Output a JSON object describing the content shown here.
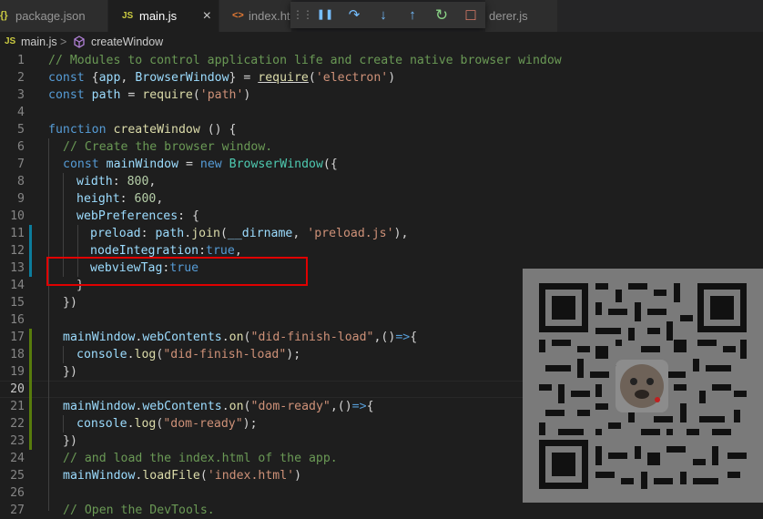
{
  "tabs": [
    {
      "icon": "{}",
      "label": "package.json"
    },
    {
      "icon": "JS",
      "label": "main.js",
      "close": "×"
    },
    {
      "icon": "<>",
      "label": "index.ht"
    },
    {
      "icon": "",
      "label": "derer.js"
    }
  ],
  "debug_toolbar": {
    "grip": "⋮⋮",
    "pause": "❚❚",
    "step_over": "↷",
    "step_into": "↓",
    "step_out": "↑",
    "restart": "↻",
    "stop": "□"
  },
  "breadcrumb": {
    "file_icon": "JS",
    "file": "main.js",
    "separator": ">",
    "symbol": "createWindow"
  },
  "editor": {
    "line_numbers": [
      "1",
      "2",
      "3",
      "4",
      "5",
      "6",
      "7",
      "8",
      "9",
      "10",
      "11",
      "12",
      "13",
      "14",
      "15",
      "16",
      "17",
      "18",
      "19",
      "20",
      "21",
      "22",
      "23",
      "24",
      "25",
      "26",
      "27"
    ],
    "lines": {
      "l1": {
        "a": "// Modules to control application life and create native browser window"
      },
      "l2": {
        "a": "const",
        "b": " {",
        "c": "app",
        "d": ", ",
        "e": "BrowserWindow",
        "f": "} = ",
        "g": "require",
        "h": "(",
        "i": "'electron'",
        "j": ")"
      },
      "l3": {
        "a": "const",
        "b": " ",
        "c": "path",
        "d": " = ",
        "e": "require",
        "f": "(",
        "g": "'path'",
        "h": ")"
      },
      "l5": {
        "a": "function",
        "b": " ",
        "c": "createWindow",
        "d": " () {"
      },
      "l6": {
        "a": "// Create the browser window."
      },
      "l7": {
        "a": "const",
        "b": " ",
        "c": "mainWindow",
        "d": " = ",
        "e": "new",
        "f": " ",
        "g": "BrowserWindow",
        "h": "({"
      },
      "l8": {
        "a": "width",
        "b": ": ",
        "c": "800",
        "d": ","
      },
      "l9": {
        "a": "height",
        "b": ": ",
        "c": "600",
        "d": ","
      },
      "l10": {
        "a": "webPreferences",
        "b": ": {"
      },
      "l11": {
        "a": "preload",
        "b": ": ",
        "c": "path",
        "d": ".",
        "e": "join",
        "f": "(",
        "g": "__dirname",
        "h": ", ",
        "i": "'preload.js'",
        "j": "),"
      },
      "l12": {
        "a": "nodeIntegration",
        "b": ":",
        "c": "true",
        "d": ","
      },
      "l13": {
        "a": "webviewTag",
        "b": ":",
        "c": "true"
      },
      "l14": {
        "a": "}"
      },
      "l15": {
        "a": "})"
      },
      "l17": {
        "a": "mainWindow",
        "b": ".",
        "c": "webContents",
        "d": ".",
        "e": "on",
        "f": "(",
        "g": "\"did-finish-load\"",
        "h": ",()",
        "i": "=>",
        "j": "{"
      },
      "l18": {
        "a": "console",
        "b": ".",
        "c": "log",
        "d": "(",
        "e": "\"did-finish-load\"",
        "f": ");"
      },
      "l19": {
        "a": "})"
      },
      "l21": {
        "a": "mainWindow",
        "b": ".",
        "c": "webContents",
        "d": ".",
        "e": "on",
        "f": "(",
        "g": "\"dom-ready\"",
        "h": ",()",
        "i": "=>",
        "j": "{"
      },
      "l22": {
        "a": "console",
        "b": ".",
        "c": "log",
        "d": "(",
        "e": "\"dom-ready\"",
        "f": ");"
      },
      "l23": {
        "a": "})"
      },
      "l24": {
        "a": "// and load the index.html of the app."
      },
      "l25": {
        "a": "mainWindow",
        "b": ".",
        "c": "loadFile",
        "d": "(",
        "e": "'index.html'",
        "f": ")"
      },
      "l27": {
        "a": "// Open the DevTools."
      }
    }
  },
  "colors": {
    "background": "#1e1e1e",
    "tabbar": "#252526",
    "highlight_box": "#e00000",
    "git_added": "#587c0c",
    "git_modified": "#0c7d9d"
  }
}
